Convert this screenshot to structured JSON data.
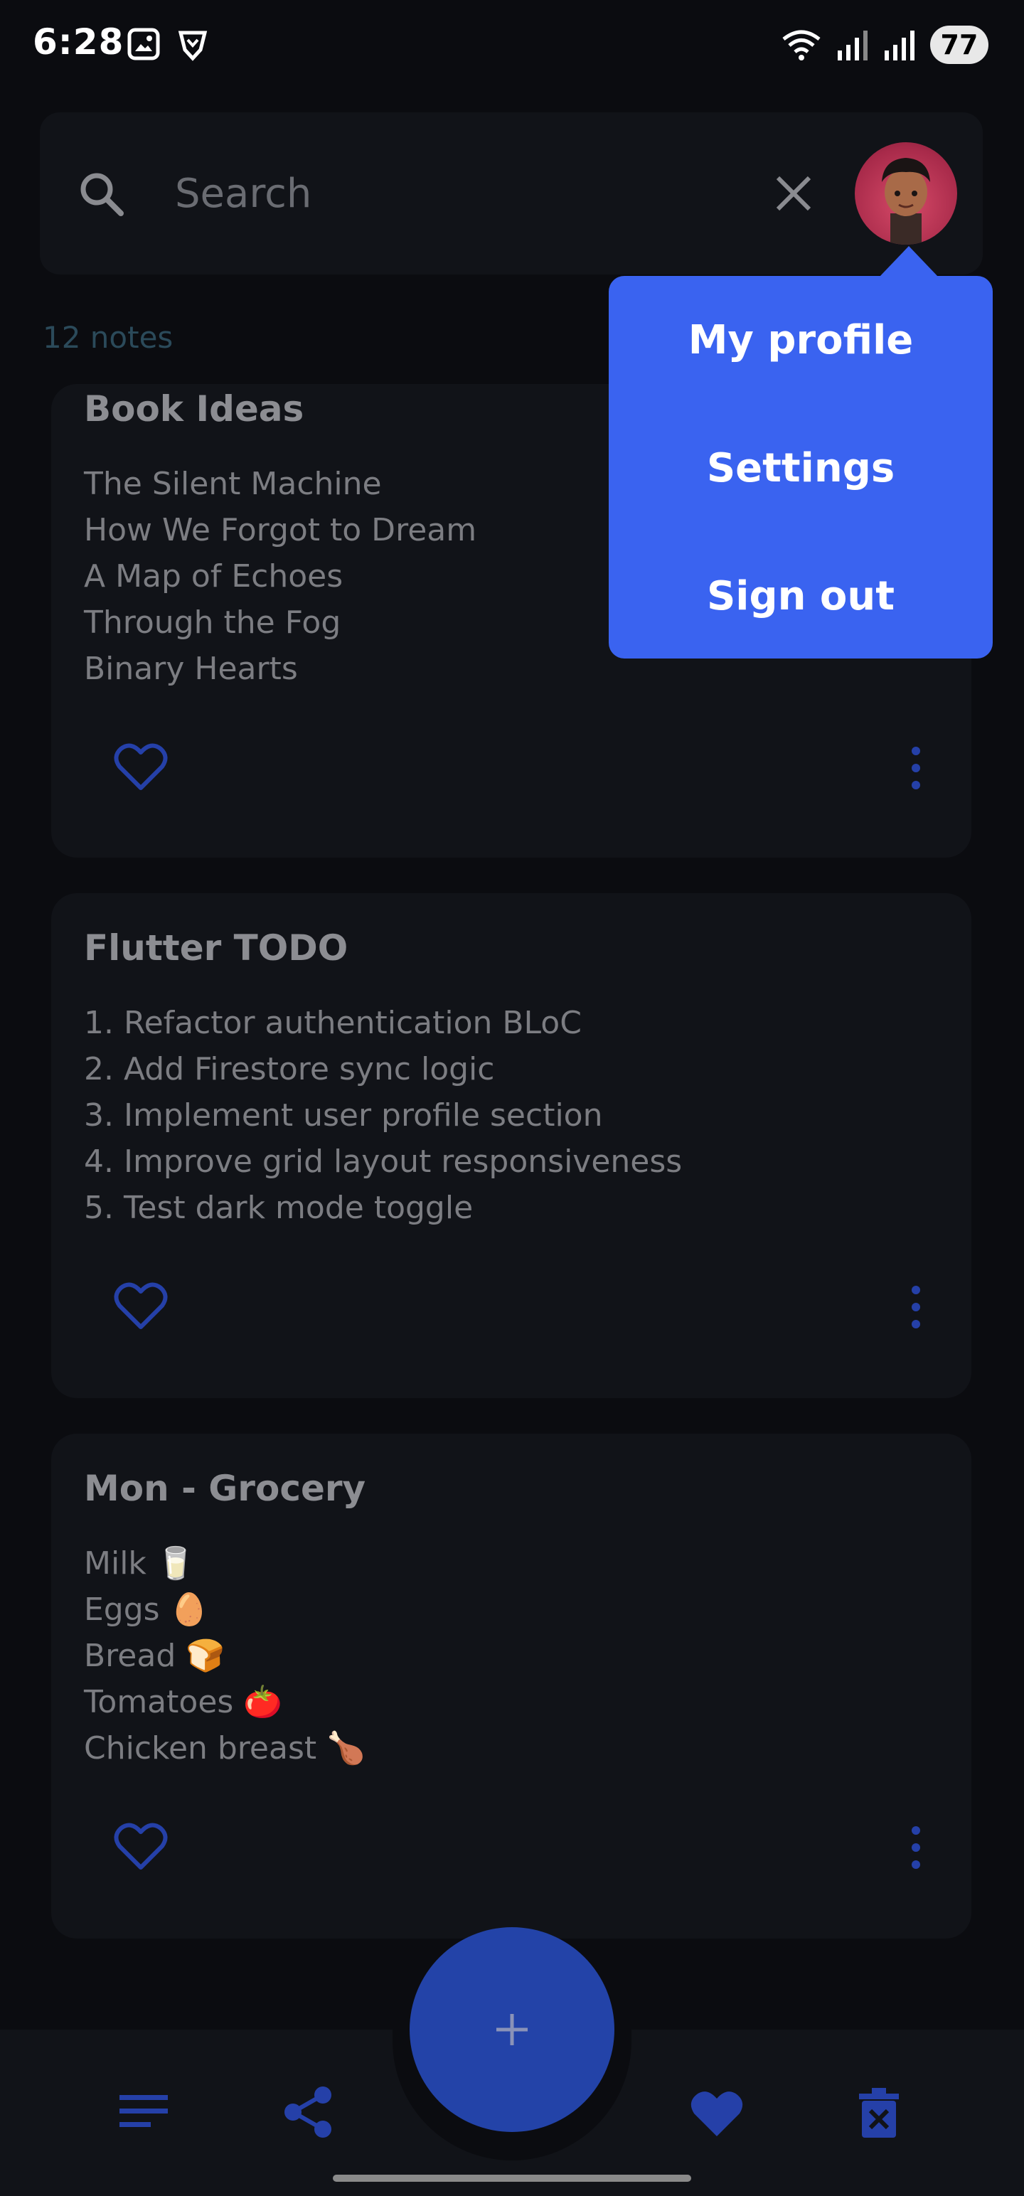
{
  "status_bar": {
    "time": "6:28",
    "battery": "77"
  },
  "search": {
    "placeholder": "Search"
  },
  "notes_count": "12 notes",
  "notes": [
    {
      "title": "Book Ideas",
      "lines": [
        "The Silent Machine",
        "How We Forgot to Dream",
        "A Map of Echoes",
        "Through the Fog",
        "Binary Hearts"
      ]
    },
    {
      "title": "Flutter TODO",
      "lines": [
        "1. Refactor authentication BLoC",
        "2. Add Firestore sync logic",
        "3. Implement user profile section",
        "4. Improve grid layout responsiveness",
        "5. Test dark mode toggle"
      ]
    },
    {
      "title": "Mon - Grocery",
      "lines": [
        "Milk 🥛",
        "Eggs 🥚",
        "Bread 🍞",
        "Tomatoes 🍅",
        "Chicken breast 🍗"
      ]
    }
  ],
  "profile_menu": {
    "items": [
      "My profile",
      "Settings",
      "Sign out"
    ]
  },
  "icons": {
    "search": "search-icon",
    "clear": "close-icon",
    "favorite": "heart-outline-icon",
    "more": "more-vert-icon",
    "add": "plus-icon",
    "list": "menu-lines-icon",
    "share": "share-icon",
    "favorites": "heart-filled-icon",
    "trash": "trash-x-icon"
  },
  "colors": {
    "accent": "#3a63f0",
    "fab": "#2343a8",
    "icon_blue": "#2540a8",
    "background": "#0b0c10",
    "card": "#111318"
  }
}
